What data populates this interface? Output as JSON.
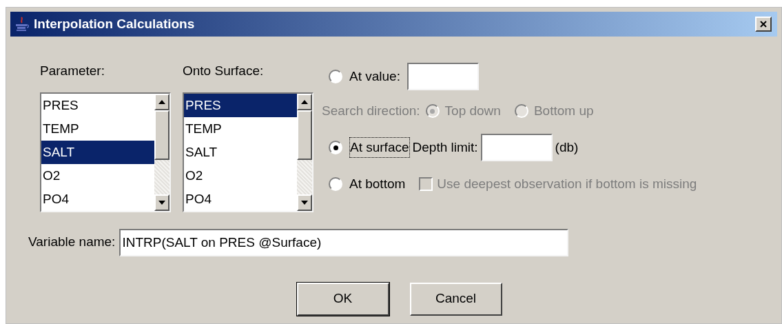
{
  "window": {
    "title": "Interpolation Calculations"
  },
  "lists": [
    {
      "label": "Parameter:",
      "items": [
        {
          "text": "PRES",
          "selected": false
        },
        {
          "text": "TEMP",
          "selected": false
        },
        {
          "text": "SALT",
          "selected": true
        },
        {
          "text": "O2",
          "selected": false
        },
        {
          "text": "PO4",
          "selected": false
        }
      ]
    },
    {
      "label": "Onto Surface:",
      "items": [
        {
          "text": "PRES",
          "selected": true
        },
        {
          "text": "TEMP",
          "selected": false
        },
        {
          "text": "SALT",
          "selected": false
        },
        {
          "text": "O2",
          "selected": false
        },
        {
          "text": "PO4",
          "selected": false
        }
      ]
    }
  ],
  "at_value": {
    "label": "At value:",
    "selected": false
  },
  "search_direction": {
    "label": "Search direction:",
    "disabled": true,
    "options": [
      {
        "label": "Top down",
        "selected": true
      },
      {
        "label": "Bottom up",
        "selected": false
      }
    ]
  },
  "at_surface": {
    "label": "At surface",
    "selected": true,
    "focused": true,
    "depth_label": "Depth limit:",
    "unit": "(db)"
  },
  "at_bottom": {
    "label": "At bottom",
    "selected": false,
    "checkbox": {
      "label": "Use deepest observation if bottom is missing",
      "checked": false,
      "disabled": true
    }
  },
  "variable_name": {
    "label": "Variable name:",
    "value": "INTRP(SALT on PRES @Surface)"
  },
  "buttons": [
    {
      "label": "OK",
      "default": true
    },
    {
      "label": "Cancel",
      "default": false
    }
  ]
}
